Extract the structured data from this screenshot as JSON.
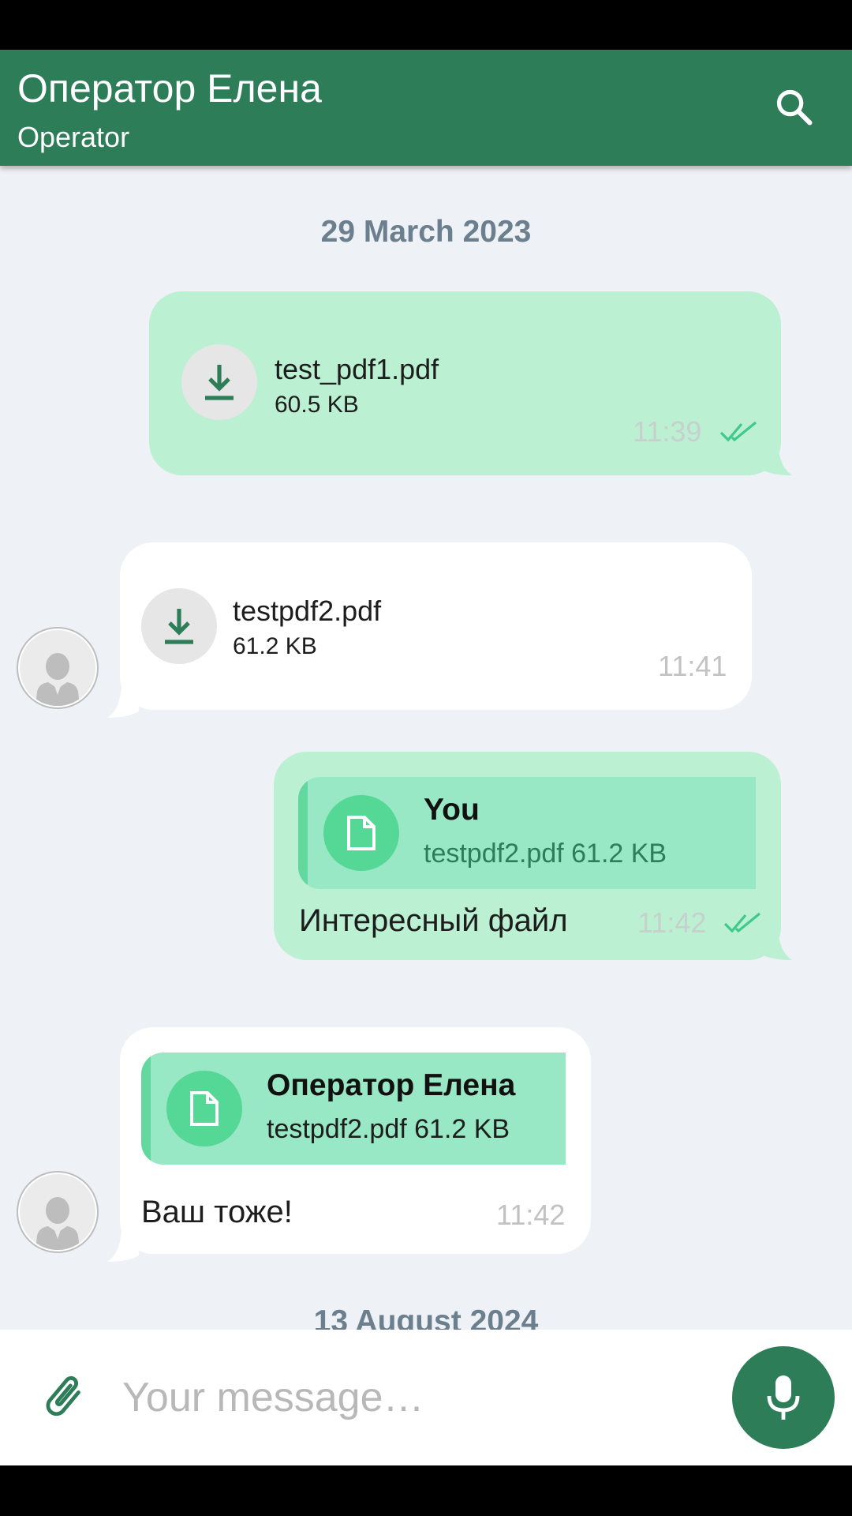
{
  "header": {
    "title": "Оператор Елена",
    "subtitle": "Operator"
  },
  "icons": {
    "search": "search-icon",
    "download": "download-icon",
    "document": "document-icon",
    "read_receipt": "double-check-icon",
    "avatar": "person-icon",
    "attach": "paperclip-icon",
    "mic": "microphone-icon"
  },
  "colors": {
    "brand": "#2e7d59",
    "outgoing_bubble": "#bbf0d2",
    "incoming_bubble": "#ffffff",
    "quote_bg": "#99e8c5",
    "quote_accent": "#62d89e",
    "read_tick": "#3fc98a",
    "chat_bg": "#eef1f5"
  },
  "chat": {
    "date_1": "29 March 2023",
    "date_2": "13 August 2024",
    "messages": [
      {
        "direction": "outgoing",
        "file_name": "test_pdf1.pdf",
        "file_size": "60.5 KB",
        "time": "11:39",
        "status": "read"
      },
      {
        "direction": "incoming",
        "file_name": "testpdf2.pdf",
        "file_size": "61.2 KB",
        "time": "11:41"
      },
      {
        "direction": "outgoing",
        "quote_author": "You",
        "quote_file": "testpdf2.pdf 61.2 KB",
        "text": "Интересный файл",
        "time": "11:42",
        "status": "read"
      },
      {
        "direction": "incoming",
        "quote_author": "Оператор Елена",
        "quote_file": "testpdf2.pdf 61.2 KB",
        "text": "Ваш тоже!",
        "time": "11:42"
      }
    ]
  },
  "composer": {
    "placeholder": "Your message…"
  }
}
